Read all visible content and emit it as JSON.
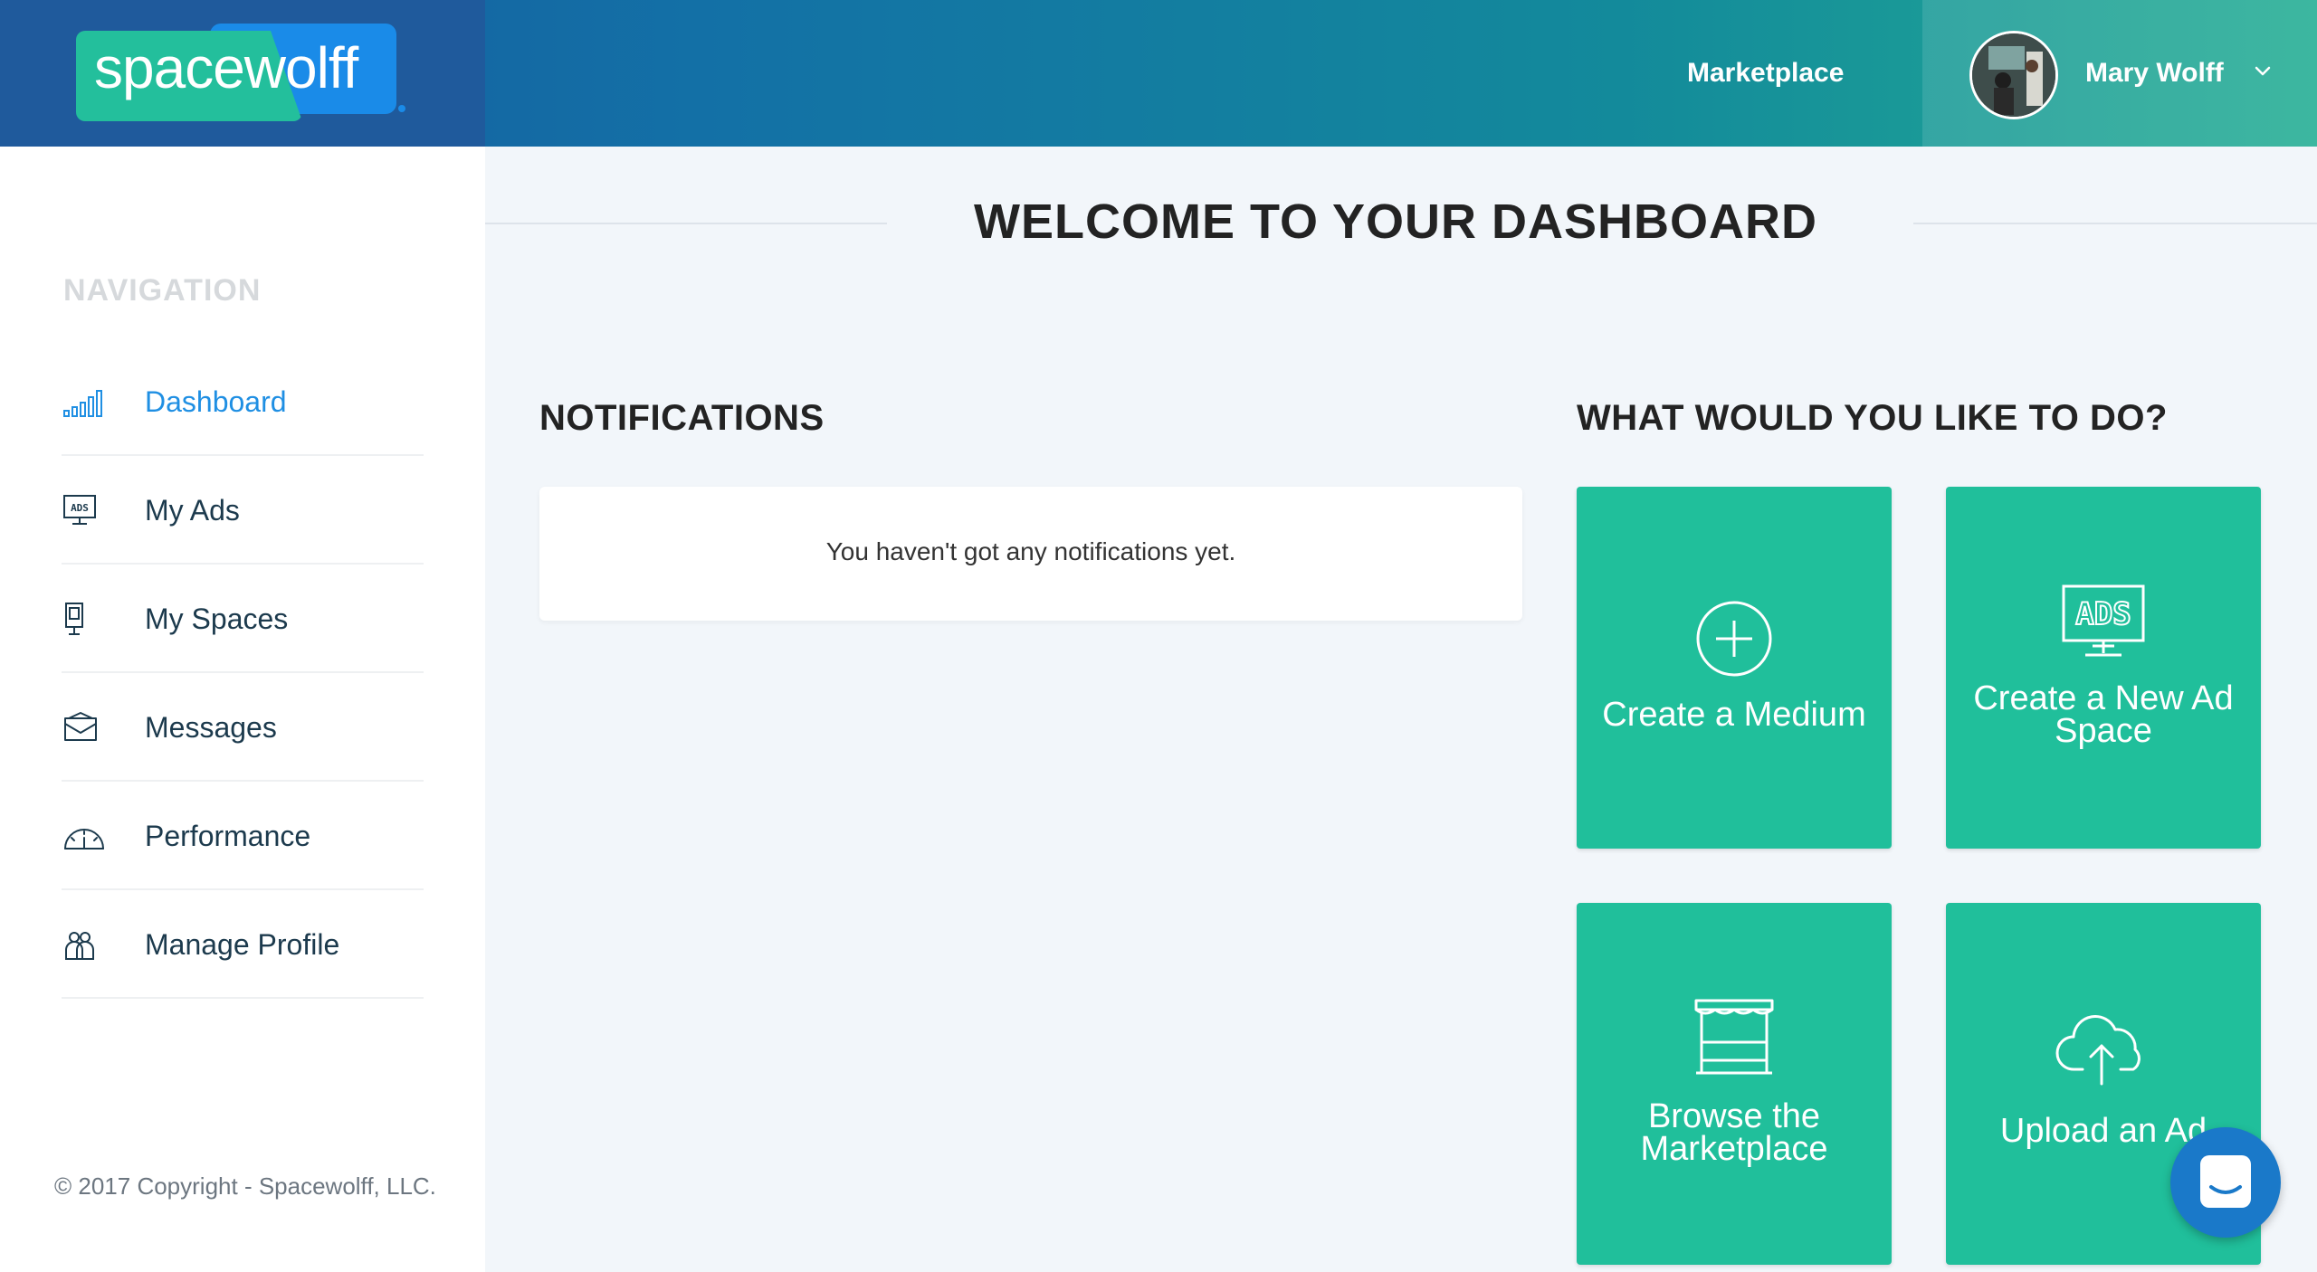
{
  "header": {
    "logo_text": "spacewolff",
    "marketplace_link": "Marketplace",
    "user_name": "Mary Wolff"
  },
  "sidebar": {
    "heading": "NAVIGATION",
    "items": [
      {
        "label": "Dashboard",
        "icon": "bar-chart-icon",
        "active": true
      },
      {
        "label": "My Ads",
        "icon": "ads-monitor-icon",
        "active": false
      },
      {
        "label": "My Spaces",
        "icon": "billboard-icon",
        "active": false
      },
      {
        "label": "Messages",
        "icon": "envelope-icon",
        "active": false
      },
      {
        "label": "Performance",
        "icon": "speedometer-icon",
        "active": false
      },
      {
        "label": "Manage Profile",
        "icon": "users-icon",
        "active": false
      }
    ],
    "copyright": "© 2017 Copyright - Spacewolff, LLC."
  },
  "main": {
    "welcome_title": "WELCOME TO YOUR DASHBOARD",
    "notifications": {
      "title": "NOTIFICATIONS",
      "empty_text": "You haven't got any notifications yet."
    },
    "actions": {
      "title": "WHAT WOULD YOU LIKE TO DO?",
      "tiles": [
        {
          "label": "Create a Medium",
          "icon": "plus-circle-icon"
        },
        {
          "label": "Create a New Ad Space",
          "icon": "ads-monitor-icon"
        },
        {
          "label": "Browse the Marketplace",
          "icon": "market-stall-icon"
        },
        {
          "label": "Upload an Ad",
          "icon": "cloud-upload-icon"
        }
      ]
    }
  },
  "colors": {
    "accent_blue": "#1f8fe3",
    "tile_green": "#20bf9b",
    "header_start": "#17599e",
    "header_end": "#22ad93"
  }
}
